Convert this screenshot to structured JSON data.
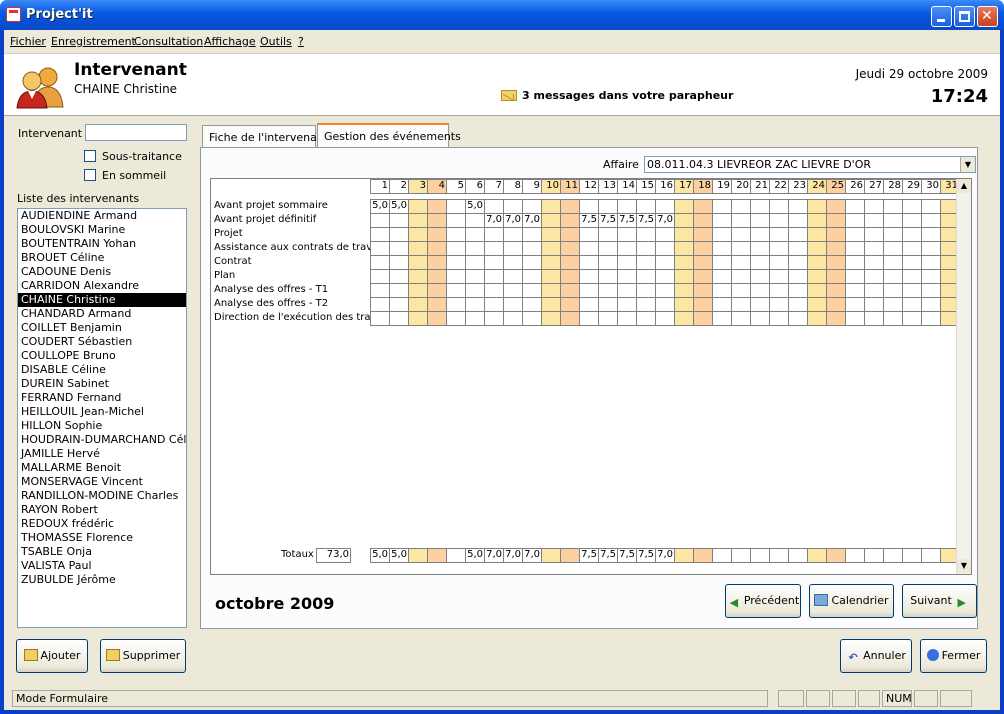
{
  "window": {
    "title": "Project'it"
  },
  "menu": [
    "Fichier",
    "Enregistrement",
    "Consultation",
    "Affichage",
    "Outils",
    "?"
  ],
  "header": {
    "title": "Intervenant",
    "name": "CHAINE Christine",
    "messages": "3 messages dans votre parapheur",
    "date": "Jeudi 29 octobre 2009",
    "time": "17:24"
  },
  "left": {
    "intervenant_label": "Intervenant",
    "intervenant_value": "",
    "sous_traitance": "Sous-traitance",
    "en_sommeil": "En sommeil",
    "list_label": "Liste des intervenants",
    "list": [
      "AUDIENDINE Armand",
      "BOULOVSKI Marine",
      "BOUTENTRAIN Yohan",
      "BROUET Céline",
      "CADOUNE Denis",
      "CARRIDON Alexandre",
      "CHAINE Christine",
      "CHANDARD Armand",
      "COILLET Benjamin",
      "COUDERT Sébastien",
      "COULLOPE Bruno",
      "DISABLE Céline",
      "DUREIN Sabinet",
      "FERRAND Fernand",
      "HEILLOUIL Jean-Michel",
      "HILLON Sophie",
      "HOUDRAIN-DUMARCHAND Céline",
      "JAMILLE Hervé",
      "MALLARME Benoit",
      "MONSERVAGE Vincent",
      "RANDILLON-MODINE Charles",
      "RAYON Robert",
      "REDOUX frédéric",
      "THOMASSE Florence",
      "TSABLE Onja",
      "VALISTA Paul",
      "ZUBULDE Jérôme"
    ],
    "selected": "CHAINE Christine"
  },
  "tabs": [
    "Fiche de l'intervenant",
    "Gestion des événements"
  ],
  "affaire": {
    "label": "Affaire",
    "value": "08.011.04.3 LIEVREOR ZAC LIEVRE D'OR"
  },
  "calendar": {
    "days": [
      1,
      2,
      3,
      4,
      5,
      6,
      7,
      8,
      9,
      10,
      11,
      12,
      13,
      14,
      15,
      16,
      17,
      18,
      19,
      20,
      21,
      22,
      23,
      24,
      25,
      26,
      27,
      28,
      29,
      30,
      31
    ],
    "saturdays": [
      3,
      10,
      17,
      24,
      31
    ],
    "sundays": [
      4,
      11,
      18,
      25
    ],
    "rows": [
      {
        "label": "Avant projet sommaire",
        "values": {
          "1": "5,0",
          "2": "5,0",
          "6": "5,0"
        }
      },
      {
        "label": "Avant projet définitif",
        "values": {
          "7": "7,0",
          "8": "7,0",
          "9": "7,0",
          "12": "7,5",
          "13": "7,5",
          "14": "7,5",
          "15": "7,5",
          "16": "7,0"
        }
      },
      {
        "label": "Projet",
        "values": {}
      },
      {
        "label": "Assistance aux contrats de travaux",
        "values": {}
      },
      {
        "label": "Contrat",
        "values": {}
      },
      {
        "label": "Plan",
        "values": {}
      },
      {
        "label": "Analyse des offres - T1",
        "values": {}
      },
      {
        "label": "Analyse des offres - T2",
        "values": {}
      },
      {
        "label": "Direction de l'exécution des travaux",
        "values": {}
      }
    ],
    "totals_label": "Totaux",
    "total": "73,0",
    "totals": {
      "1": "5,0",
      "2": "5,0",
      "6": "5,0",
      "7": "7,0",
      "8": "7,0",
      "9": "7,0",
      "12": "7,5",
      "13": "7,5",
      "14": "7,5",
      "15": "7,5",
      "16": "7,0"
    }
  },
  "month": "octobre 2009",
  "buttons": {
    "prev": "Précédent",
    "cal": "Calendrier",
    "next": "Suivant",
    "add": "Ajouter",
    "del": "Supprimer",
    "cancel": "Annuler",
    "close": "Fermer"
  },
  "status": {
    "mode": "Mode Formulaire",
    "num": "NUM"
  },
  "colors": {
    "saturday": "#fce6a4",
    "sunday": "#fcd0a0",
    "selection": "#000000",
    "titlebar": "#0a5ce6"
  }
}
